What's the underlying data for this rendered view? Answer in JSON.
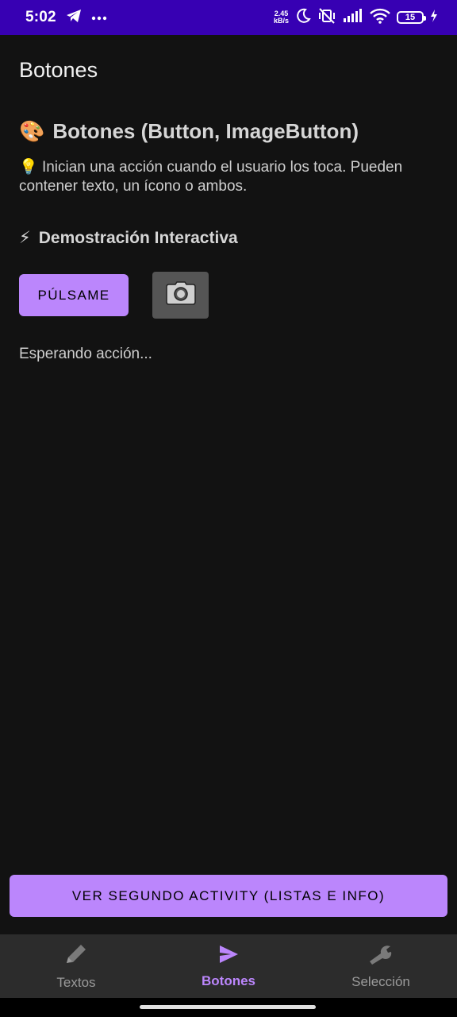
{
  "status_bar": {
    "time": "5:02",
    "speed_value": "2.45",
    "speed_unit": "kB/s",
    "battery": "15"
  },
  "toolbar": {
    "title": "Botones"
  },
  "section": {
    "title_emoji": "🎨",
    "title": "Botones (Button, ImageButton)",
    "description_emoji": "💡",
    "description": "Inician una acción cuando el usuario los toca. Pueden contener texto, un ícono o ambos."
  },
  "demo": {
    "title_emoji": "⚡",
    "title": "Demostración Interactiva",
    "primary_button_label": "PÚLSAME",
    "image_button_icon": "camera-icon",
    "status_text": "Esperando acción..."
  },
  "wide_button_label": "VER SEGUNDO ACTIVITY (LISTAS E INFO)",
  "bottom_nav": {
    "items": [
      {
        "label": "Textos",
        "icon": "pencil-icon"
      },
      {
        "label": "Botones",
        "icon": "send-icon"
      },
      {
        "label": "Selección",
        "icon": "wrench-icon"
      }
    ],
    "active_index": 1
  },
  "colors": {
    "status_bar": "#3700b3",
    "accent": "#bb86fc",
    "background": "#121212",
    "nav_background": "#2c2c2c"
  }
}
